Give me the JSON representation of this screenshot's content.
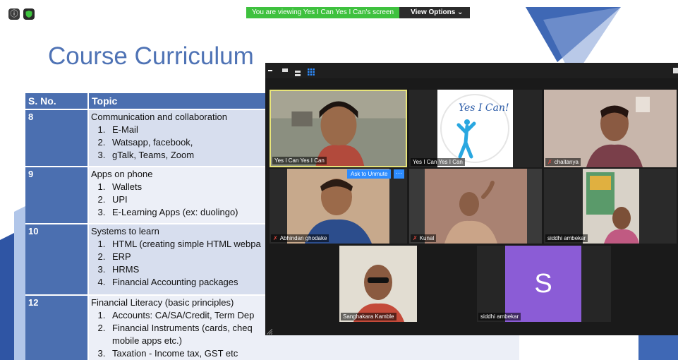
{
  "banner": {
    "text": "You are viewing Yes I Can Yes I Can's screen",
    "view_options": "View Options ⌄"
  },
  "top_icons": {
    "info": "ⓘ",
    "shield": "✔"
  },
  "slide": {
    "title": "Course Curriculum",
    "headers": {
      "sno": "S. No.",
      "topic": "Topic"
    },
    "rows": [
      {
        "no": "8",
        "title": "Communication and collaboration",
        "items": [
          "E-Mail",
          "Watsapp, facebook,",
          "gTalk, Teams, Zoom"
        ]
      },
      {
        "no": "9",
        "title": "Apps on phone",
        "items": [
          "Wallets",
          "UPI",
          "E-Learning Apps (ex: duolingo)"
        ]
      },
      {
        "no": "10",
        "title": "Systems to learn",
        "items": [
          "HTML (creating simple HTML webpa",
          "ERP",
          "HRMS",
          "Financial Accounting packages"
        ]
      },
      {
        "no": "12",
        "title": "Financial Literacy (basic principles)",
        "items": [
          "Accounts: CA/SA/Credit, Term Dep",
          "Financial Instruments (cards, cheq",
          "mobile apps etc.)",
          "Taxation - Income tax, GST etc"
        ]
      }
    ]
  },
  "meeting": {
    "participants": [
      {
        "name": "Yes I Can Yes I Can",
        "muted": false
      },
      {
        "name": "Yes I Can Yes I Can",
        "muted": false,
        "logo_text": "Yes I Can!"
      },
      {
        "name": "chaitanya",
        "muted": true
      },
      {
        "name": "Abhindan   ghodake",
        "muted": true
      },
      {
        "name": "Kunal",
        "muted": true
      },
      {
        "name": "siddhi ambekar",
        "muted": false
      },
      {
        "name": "Sanghakara Kamble",
        "muted": false
      },
      {
        "name": "siddhi ambekar",
        "muted": false,
        "avatar_letter": "S"
      }
    ],
    "ask_to_unmute": "Ask to Unmute",
    "more": "···"
  },
  "colors": {
    "accent": "#4b6fb0",
    "zoom_blue": "#2d8cff",
    "speaker_border": "#e8e47a",
    "avatar": "#8b5cd6",
    "banner": "#3ec13e"
  }
}
